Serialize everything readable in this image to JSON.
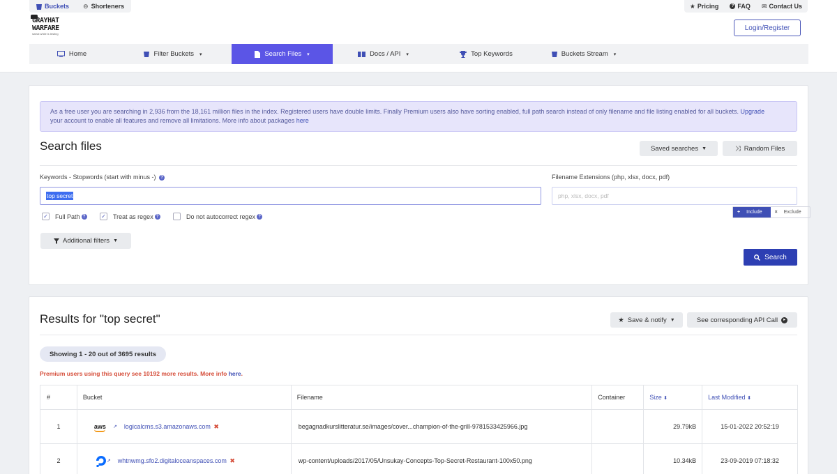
{
  "top_tabs": [
    {
      "label": "Buckets",
      "icon": "bucket-icon"
    },
    {
      "label": "Shorteners",
      "icon": "link-icon"
    }
  ],
  "top_links": [
    {
      "label": "Pricing",
      "icon": "star-icon"
    },
    {
      "label": "FAQ",
      "icon": "question-icon"
    },
    {
      "label": "Contact Us",
      "icon": "mail-icon"
    }
  ],
  "logo": {
    "line1": "GRAYHAT",
    "line2": "WARFARE",
    "tagline": "sweat while is testing"
  },
  "login_label": "Login/Register",
  "nav": [
    {
      "label": "Home",
      "icon": "monitor-icon",
      "caret": ""
    },
    {
      "label": "Filter Buckets",
      "icon": "bucket-icon",
      "caret": "▾"
    },
    {
      "label": "Search Files",
      "icon": "file-icon",
      "caret": "▾"
    },
    {
      "label": "Docs / API",
      "icon": "book-icon",
      "caret": "▾"
    },
    {
      "label": "Top Keywords",
      "icon": "trophy-icon",
      "caret": ""
    },
    {
      "label": "Buckets Stream",
      "icon": "bucket-icon",
      "caret": "▾"
    }
  ],
  "notice": {
    "text": "As a free user you are searching in 2,936 from the 18,161 million files in the index. Registered users have double limits. Finally Premium users also have sorting enabled, full path search instead of only filename and file listing enabled for all buckets. ",
    "upgrade_link": "Upgrade",
    "text2": "your account to enable all features and remove all limitations. More info about packages ",
    "here_link": "here"
  },
  "search": {
    "title": "Search files",
    "saved_label": "Saved searches",
    "random_label": "Random Files",
    "keywords_label": "Keywords - Stopwords (start with minus -)",
    "keywords_value": "top secret",
    "ext_label": "Filename Extensions (php, xlsx, docx, pdf)",
    "ext_placeholder": "php, xlsx, docx, pdf",
    "include_label": "Include",
    "exclude_label": "Exclude",
    "full_path_label": "Full Path",
    "regex_label": "Treat as regex",
    "autocorrect_label": "Do not autocorrect regex",
    "additional_label": "Additional filters",
    "search_button": "Search"
  },
  "results": {
    "title": "Results for \"top secret\"",
    "save_notify": "Save & notify",
    "api_call": "See corresponding API Call",
    "showing": "Showing 1 - 20 out of 3695 results",
    "premium_text": "Premium users using this query see 10192 more results. More info ",
    "premium_link": "here",
    "premium_end": ".",
    "columns": [
      "#",
      "Bucket",
      "Filename",
      "Container",
      "Size",
      "Last Modified"
    ],
    "rows": [
      {
        "num": "1",
        "provider": "aws",
        "bucket": "logicalcms.s3.amazonaws.com",
        "filename": "begagnadkurslitteratur.se/images/cover...champion-of-the-grill-9781533425966.jpg",
        "container": "",
        "size": "29.79kB",
        "modified": "15-01-2022 20:52:19"
      },
      {
        "num": "2",
        "provider": "digitalocean",
        "bucket": "whtnwmg.sfo2.digitaloceanspaces.com",
        "filename": "wp-content/uploads/2017/05/Unsukay-Concepts-Top-Secret-Restaurant-100x50.png",
        "container": "",
        "size": "10.34kB",
        "modified": "23-09-2019 07:18:32"
      }
    ]
  },
  "colors": {
    "accent": "#5b55e6",
    "primary": "#2d3fb3",
    "link": "#3f4fb5",
    "warning": "#d54c38"
  }
}
